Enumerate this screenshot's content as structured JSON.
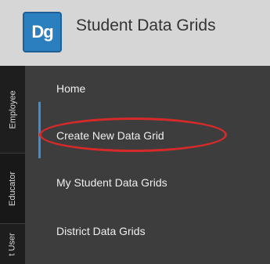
{
  "header": {
    "logo_text": "Dg",
    "title": "Student Data Grids"
  },
  "rail": {
    "tabs": [
      {
        "label": "Employee"
      },
      {
        "label": "Educator"
      },
      {
        "label": "t User"
      }
    ]
  },
  "menu": {
    "items": [
      {
        "label": "Home"
      },
      {
        "label": "Create New Data Grid"
      },
      {
        "label": "My Student Data Grids"
      },
      {
        "label": "District Data Grids"
      }
    ]
  },
  "colors": {
    "accent": "#3a8fd9",
    "highlight": "#d62a2a",
    "logo": "#2c7fbf"
  }
}
